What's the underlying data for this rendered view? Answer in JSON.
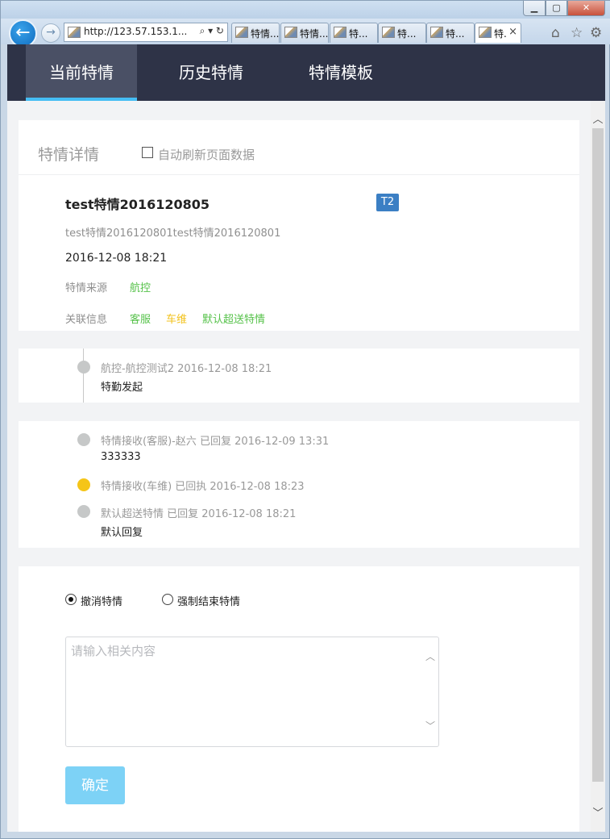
{
  "browser": {
    "window_controls": {
      "minimize": "▁",
      "maximize": "▢",
      "close": "✕"
    },
    "address": {
      "url": "http://123.57.153.1...",
      "controls": "⌕ ▾ ↻"
    },
    "tabs": [
      {
        "label": "特情..."
      },
      {
        "label": "特情..."
      },
      {
        "label": "特..."
      },
      {
        "label": "特..."
      },
      {
        "label": "特..."
      },
      {
        "label": "特.",
        "active": true
      }
    ],
    "toolbar_icons": [
      "home-icon",
      "star-icon",
      "gear-icon"
    ]
  },
  "nav": {
    "tabs": [
      {
        "label": "当前特情",
        "active": true
      },
      {
        "label": "历史特情"
      },
      {
        "label": "特情模板"
      }
    ]
  },
  "detail": {
    "title": "特情详情",
    "auto_refresh_label": "自动刷新页面数据",
    "auto_refresh_checked": false,
    "event_name": "test特情2016120805",
    "level_badge": "T2",
    "description": "test特情2016120801test特情2016120801",
    "time": "2016-12-08 18:21",
    "source_label": "特情来源",
    "source_value": "航控",
    "related_label": "关联信息",
    "related": [
      "客服",
      "车维",
      "默认超送特情"
    ]
  },
  "timeline_origin": {
    "items": [
      {
        "head": "航控-航控测试2   2016-12-08 18:21",
        "body": "特勤发起"
      }
    ]
  },
  "timeline_replies": {
    "items": [
      {
        "head": "特情接收(客服)-赵六  已回复   2016-12-09 13:31",
        "body": "333333",
        "status": "gray"
      },
      {
        "head": "特情接收(车维)  已回执   2016-12-08 18:23",
        "body": "",
        "status": "yellow"
      },
      {
        "head": "默认超送特情  已回复   2016-12-08 18:21",
        "body": "默认回复",
        "status": "gray"
      }
    ]
  },
  "action": {
    "options": [
      {
        "label": "撤消特情",
        "selected": true
      },
      {
        "label": "强制结束特情",
        "selected": false
      }
    ],
    "textarea_placeholder": "请输入相关内容",
    "confirm_label": "确定"
  },
  "colors": {
    "nav_bg": "#2e3347",
    "nav_active": "#4a5065",
    "nav_indicator": "#45bdf4",
    "badge": "#3b7fc4",
    "green": "#56c24a",
    "yellow": "#f2c21b",
    "confirm": "#7dd2f6"
  }
}
